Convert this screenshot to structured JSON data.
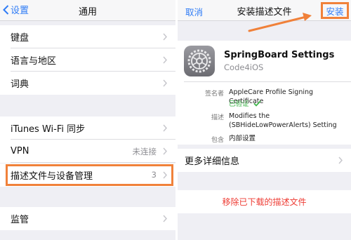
{
  "left_screen": {
    "back_label": "设置",
    "title": "通用",
    "rows": [
      {
        "label": "键盘",
        "value": ""
      },
      {
        "label": "语言与地区",
        "value": ""
      },
      {
        "label": "词典",
        "value": ""
      },
      {
        "label": "iTunes Wi-Fi 同步",
        "value": ""
      },
      {
        "label": "VPN",
        "value": "未连接"
      },
      {
        "label": "描述文件与设备管理",
        "value": "3"
      },
      {
        "label": "监管",
        "value": ""
      }
    ]
  },
  "right_screen": {
    "cancel_label": "取消",
    "title": "安装描述文件",
    "install_label": "安装",
    "profile": {
      "name": "SpringBoard Settings",
      "org": "Code4iOS",
      "signed_by_label": "签名者",
      "signed_by_value": "AppleCare Profile Signing Certificate",
      "verified_label": "已验证",
      "description_label": "描述",
      "description_value": "Modifies the (SBHideLowPowerAlerts) Setting",
      "contains_label": "包含",
      "contains_value": "内部设置"
    },
    "more_details_label": "更多详细信息",
    "remove_label": "移除已下载的描述文件"
  },
  "colors": {
    "ios_blue": "#2f7cf6",
    "highlight_orange": "#f0813a",
    "verified_green": "#3eb54a",
    "destructive_red": "#ee3b33"
  },
  "icons": [
    "chevron-left-icon",
    "chevron-right-icon",
    "gear-icon",
    "checkmark-icon",
    "arrow-annotation"
  ]
}
